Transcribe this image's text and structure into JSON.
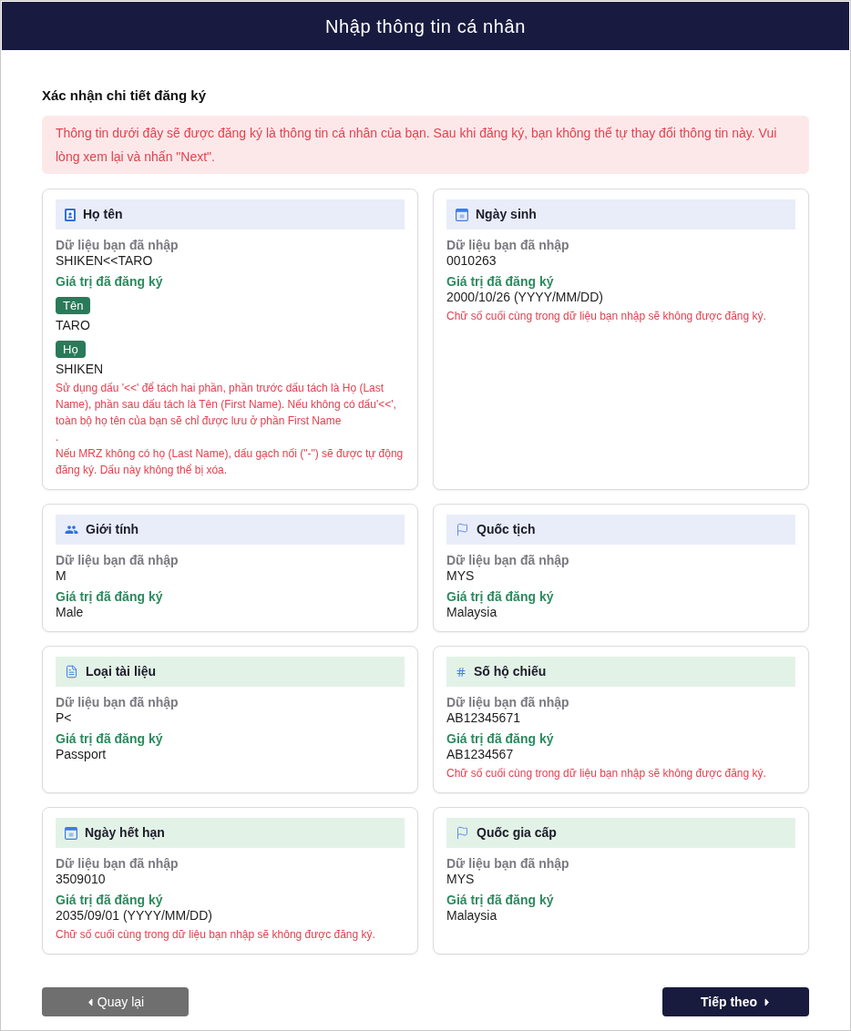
{
  "header": {
    "title": "Nhập thông tin cá nhân"
  },
  "section": {
    "title": "Xác nhận chi tiết đăng ký",
    "notice": "Thông tin dưới đây sẽ được đăng ký là thông tin cá nhân của bạn. Sau khi đăng ký, bạn không thể tự thay đổi thông tin này. Vui lòng xem lại và nhấn \"Next\"."
  },
  "fields": [
    {
      "kind": "name",
      "title": "Họ tên",
      "color": "#e9edf9",
      "entered_label": "Dữ liệu bạn đã nhập",
      "entered": "SHIKEN<<TARO",
      "registered_label": "Giá trị đã đăng ký",
      "parts": [
        {
          "tag": "Tên",
          "value": "TARO"
        },
        {
          "tag": "Họ",
          "value": "SHIKEN"
        }
      ],
      "notes": [
        "Sử dụng dấu '<<' để tách hai phần, phần trước dấu tách là Họ (Last Name), phần sau dấu tách là Tên (First Name). Nếu không có dấu'<<', toàn bộ họ tên của bạn sẽ chỉ được lưu ở phần First Name",
        ".",
        "Nếu MRZ không có họ (Last Name), dấu gạch nối (\"-\") sẽ được tự động đăng ký. Dấu này không thể bị xóa."
      ]
    },
    {
      "kind": "date",
      "title": "Ngày sinh",
      "color": "#e9edf9",
      "entered_label": "Dữ liệu bạn đã nhập",
      "entered": "0010263",
      "registered_label": "Giá trị đã đăng ký",
      "registered": "2000/10/26 (YYYY/MM/DD)",
      "notes": [
        "Chữ số cuối cùng trong dữ liệu bạn nhập sẽ không được đăng ký."
      ]
    },
    {
      "kind": "gender",
      "title": "Giới tính",
      "color": "#e9edf9",
      "entered_label": "Dữ liệu bạn đã nhập",
      "entered": "M",
      "registered_label": "Giá trị đã đăng ký",
      "registered": "Male"
    },
    {
      "kind": "country",
      "title": "Quốc tịch",
      "color": "#e9edf9",
      "entered_label": "Dữ liệu bạn đã nhập",
      "entered": "MYS",
      "registered_label": "Giá trị đã đăng ký",
      "registered": "Malaysia"
    },
    {
      "kind": "document",
      "title": "Loại tài liệu",
      "color": "#e3f2e7",
      "entered_label": "Dữ liệu bạn đã nhập",
      "entered": "P<",
      "registered_label": "Giá trị đã đăng ký",
      "registered": "Passport"
    },
    {
      "kind": "number",
      "title": "Số hộ chiếu",
      "color": "#e3f2e7",
      "entered_label": "Dữ liệu bạn đã nhập",
      "entered": "AB12345671",
      "registered_label": "Giá trị đã đăng ký",
      "registered": "AB1234567",
      "notes": [
        "Chữ số cuối cùng trong dữ liệu bạn nhập sẽ không được đăng ký."
      ]
    },
    {
      "kind": "date",
      "title": "Ngày hết hạn",
      "color": "#e3f2e7",
      "entered_label": "Dữ liệu bạn đã nhập",
      "entered": "3509010",
      "registered_label": "Giá trị đã đăng ký",
      "registered": "2035/09/01 (YYYY/MM/DD)",
      "notes": [
        "Chữ số cuối cùng trong dữ liệu bạn nhập sẽ không được đăng ký."
      ]
    },
    {
      "kind": "country",
      "title": "Quốc gia cấp",
      "color": "#e3f2e7",
      "entered_label": "Dữ liệu bạn đã nhập",
      "entered": "MYS",
      "registered_label": "Giá trị đã đăng ký",
      "registered": "Malaysia"
    }
  ],
  "buttons": [
    {
      "kind": "back",
      "label": "Quay lại"
    },
    {
      "kind": "next",
      "label": "Tiếp theo"
    }
  ]
}
